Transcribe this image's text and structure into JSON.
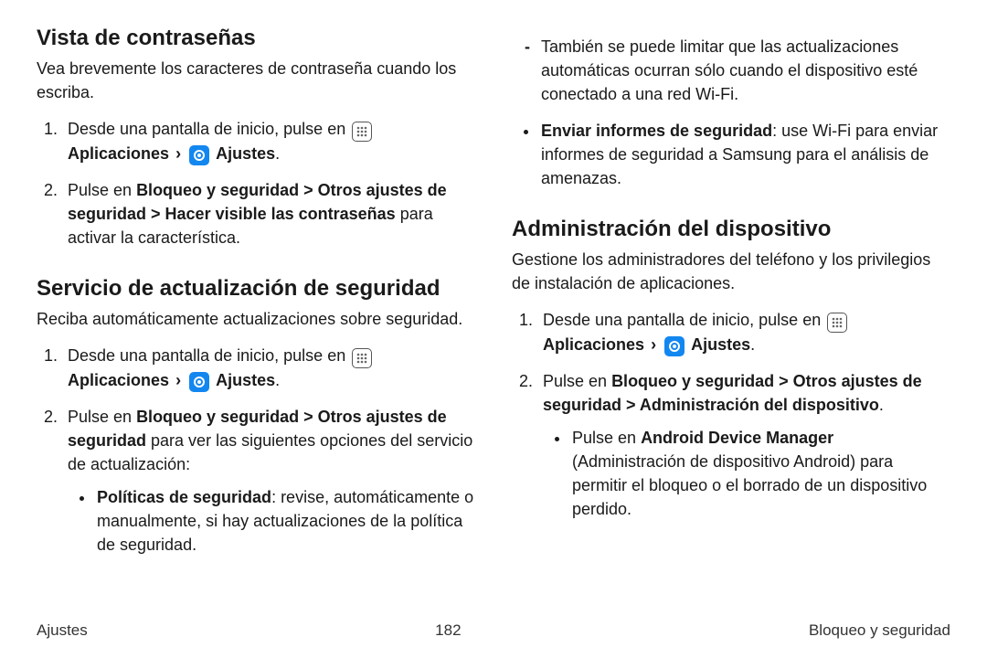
{
  "left": {
    "section1": {
      "heading": "Vista de contraseñas",
      "intro": "Vea brevemente los caracteres de contraseña cuando los escriba.",
      "step1_pre": "Desde una pantalla de inicio, pulse en ",
      "apps_label": "Aplicaciones",
      "settings_label": "Ajustes",
      "step2_pre": "Pulse en ",
      "step2_bold": "Bloqueo y seguridad > Otros ajustes de seguridad > Hacer visible las contraseñas",
      "step2_post": " para activar la característica."
    },
    "section2": {
      "heading": "Servicio de actualización de seguridad",
      "intro": "Reciba automáticamente actualizaciones sobre seguridad.",
      "step1_pre": "Desde una pantalla de inicio, pulse en ",
      "apps_label": "Aplicaciones",
      "settings_label": "Ajustes",
      "step2_pre": "Pulse en ",
      "step2_bold": "Bloqueo y seguridad > Otros ajustes de seguridad",
      "step2_post": " para ver las siguientes opciones del servicio de actualización:",
      "bullet1_bold": "Políticas de seguridad",
      "bullet1_rest": ": revise, automáticamente o manualmente, si hay actualizaciones de la política de seguridad."
    }
  },
  "right": {
    "dash_item": "También se puede limitar que las actualizaciones automáticas ocurran sólo cuando el dispositivo esté conectado a una red Wi-Fi.",
    "bullet_sec_bold": "Enviar informes de seguridad",
    "bullet_sec_rest": ": use Wi-Fi para enviar informes de seguridad a Samsung para el análisis de amenazas.",
    "section3": {
      "heading": "Administración del dispositivo",
      "intro": "Gestione los administradores del teléfono y los privilegios de instalación de aplicaciones.",
      "step1_pre": "Desde una pantalla de inicio, pulse en ",
      "apps_label": "Aplicaciones",
      "settings_label": "Ajustes",
      "step2_pre": "Pulse en ",
      "step2_bold": "Bloqueo y seguridad > Otros ajustes de seguridad > Administración del dispositivo",
      "bullet_pre": "Pulse en ",
      "bullet_bold": "Android Device Manager",
      "bullet_post": " (Administración de dispositivo Android) para permitir el bloqueo o el borrado de un dispositivo perdido."
    }
  },
  "footer": {
    "left": "Ajustes",
    "center": "182",
    "right": "Bloqueo y seguridad"
  }
}
